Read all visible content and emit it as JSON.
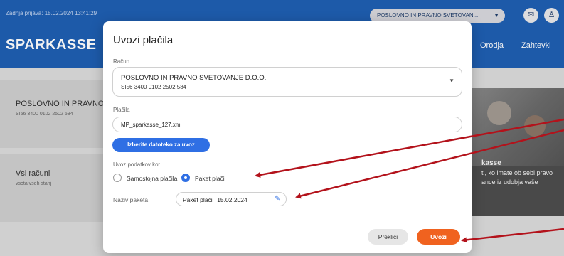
{
  "header": {
    "last_login": "Zadnja prijava: 15.02.2024 13:41:29",
    "account_selector": "POSLOVNO IN PRAVNO SVETOVAN...",
    "brand": "SPARKASSE",
    "nav": [
      "Orodja",
      "Zahtevki"
    ],
    "icons": [
      "mail-icon",
      "user-icon"
    ]
  },
  "background": {
    "account_card": {
      "name": "POSLOVNO IN PRAVNO",
      "iban": "SI56 3400 0102 2502 584"
    },
    "all_accounts_card": {
      "title": "Vsi računi",
      "subtitle": "vsota vseh stanj"
    },
    "promo": {
      "title": "kasse",
      "line1": "ti, ko imate ob sebi pravo",
      "line2": "ance iz udobja vaše"
    }
  },
  "dialog": {
    "title": "Uvozi plačila",
    "account_label": "Račun",
    "account_name": "POSLOVNO IN PRAVNO SVETOVANJE D.O.O.",
    "account_iban": "SI56 3400 0102 2502 584",
    "payments_label": "Plačila",
    "file_name": "MP_sparkasse_127.xml",
    "choose_file_button": "Izberite datoteko za uvoz",
    "import_as_label": "Uvoz podatkov kot",
    "options": [
      {
        "label": "Samostojna plačila",
        "checked": false
      },
      {
        "label": "Paket plačil",
        "checked": true
      }
    ],
    "package_name_label": "Naziv paketa",
    "package_name_value": "Paket plačil_15.02.2024",
    "cancel_button": "Prekliči",
    "import_button": "Uvozi"
  },
  "colors": {
    "brand_blue": "#1f5fb3",
    "primary_button": "#2f6fe4",
    "accent_orange": "#f0621f",
    "annotation_arrow": "#b3121b"
  }
}
